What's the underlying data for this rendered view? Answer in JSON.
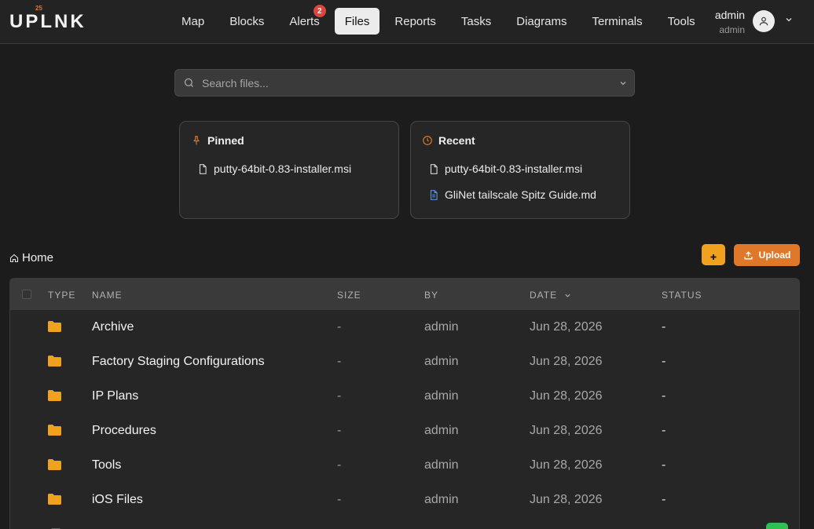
{
  "app": {
    "logo": "UPLNK",
    "logo_sup": "25"
  },
  "nav": {
    "items": [
      {
        "label": "Map"
      },
      {
        "label": "Blocks"
      },
      {
        "label": "Alerts",
        "badge": "2"
      },
      {
        "label": "Files",
        "active": true
      },
      {
        "label": "Reports"
      },
      {
        "label": "Tasks"
      },
      {
        "label": "Diagrams"
      },
      {
        "label": "Terminals"
      },
      {
        "label": "Tools"
      }
    ]
  },
  "user": {
    "name": "admin",
    "role": "admin"
  },
  "search": {
    "placeholder": "Search files..."
  },
  "pinned": {
    "title": "Pinned",
    "items": [
      {
        "name": "putty-64bit-0.83-installer.msi",
        "icon": "file-icon"
      }
    ]
  },
  "recent": {
    "title": "Recent",
    "items": [
      {
        "name": "putty-64bit-0.83-installer.msi",
        "icon": "file-icon"
      },
      {
        "name": "GliNet tailscale Spitz Guide.md",
        "icon": "markdown-file-icon"
      }
    ]
  },
  "breadcrumb": {
    "home": "Home"
  },
  "actions": {
    "upload_label": "Upload",
    "new_folder_icon": "folder-plus-icon"
  },
  "table": {
    "headers": {
      "type": "TYPE",
      "name": "NAME",
      "size": "SIZE",
      "by": "BY",
      "date": "DATE",
      "status": "STATUS"
    },
    "rows": [
      {
        "type": "folder",
        "name": "Archive",
        "size": "-",
        "by": "admin",
        "date": "Jun 28, 2026",
        "status": "-"
      },
      {
        "type": "folder",
        "name": "Factory Staging Configurations",
        "size": "-",
        "by": "admin",
        "date": "Jun 28, 2026",
        "status": "-"
      },
      {
        "type": "folder",
        "name": "IP Plans",
        "size": "-",
        "by": "admin",
        "date": "Jun 28, 2026",
        "status": "-"
      },
      {
        "type": "folder",
        "name": "Procedures",
        "size": "-",
        "by": "admin",
        "date": "Jun 28, 2026",
        "status": "-"
      },
      {
        "type": "folder",
        "name": "Tools",
        "size": "-",
        "by": "admin",
        "date": "Jun 28, 2026",
        "status": "-"
      },
      {
        "type": "folder",
        "name": "iOS Files",
        "size": "-",
        "by": "admin",
        "date": "Jun 28, 2026",
        "status": "-"
      }
    ]
  },
  "colors": {
    "accent": "#e0782a",
    "folder": "#f0a21e",
    "badge": "#e0443c",
    "background": "#1c1c1c"
  }
}
